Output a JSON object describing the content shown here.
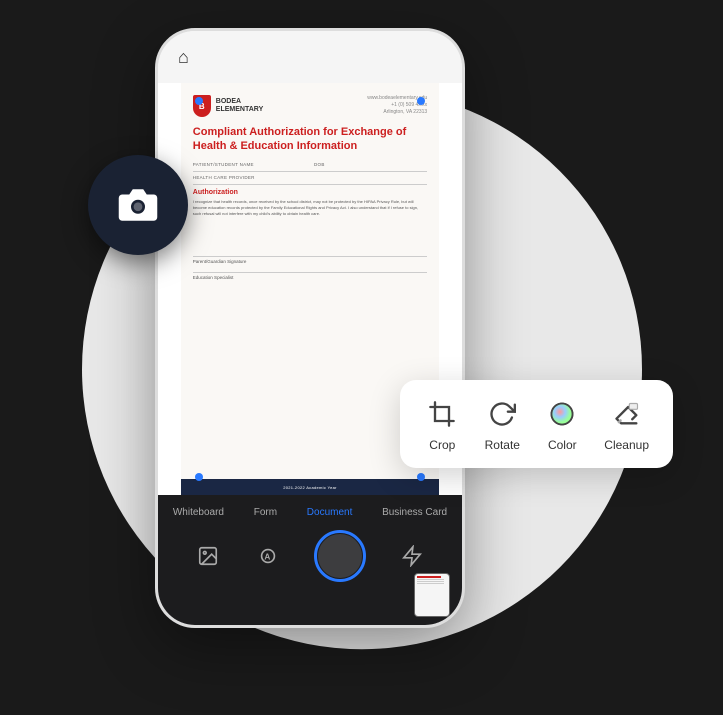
{
  "scene": {
    "bg_color": "#1a1a1a"
  },
  "phone": {
    "home_icon": "⌂",
    "document": {
      "logo_letter": "B",
      "school_name_line1": "BODEA",
      "school_name_line2": "ELEMENTARY",
      "address_line1": "www.bodeaelementary.edu",
      "address_line2": "+1 (0) 509 4x.xx",
      "address_line3": "Arlington, VA 22313",
      "title": "Compliant Authorization for Exchange of Health & Education Information",
      "label1": "PATIENT/STUDENT NAME",
      "label2": "DOB",
      "provider_label": "HEALTH CARE PROVIDER",
      "section_title": "Authorization",
      "body_text": "I recognize that health records, once received by the school district, may not be protected by the HIPAA Privacy Rule, but will become education records protected by the Family Educational Rights and Privacy Act. I also understand that if I refuse to sign, such refusal will not interfere with my child's ability to obtain health care.",
      "signature_label": "Parent/Guardian Signature",
      "specialist_label": "Education Specialist",
      "footer_text": "2021-2022 Academic Year"
    }
  },
  "nav_tabs": [
    {
      "label": "Whiteboard",
      "active": false
    },
    {
      "label": "Form",
      "active": false
    },
    {
      "label": "Document",
      "active": true
    },
    {
      "label": "Business Card",
      "active": false
    }
  ],
  "nav_actions": [
    {
      "name": "gallery-icon",
      "symbol": "⊞"
    },
    {
      "name": "text-icon",
      "symbol": "Ⓐ"
    },
    {
      "name": "capture-button",
      "symbol": ""
    },
    {
      "name": "flash-icon",
      "symbol": "⚡"
    },
    {
      "name": "thumbnail",
      "symbol": ""
    }
  ],
  "toolbar": {
    "tools": [
      {
        "name": "crop",
        "label": "Crop"
      },
      {
        "name": "rotate",
        "label": "Rotate"
      },
      {
        "name": "color",
        "label": "Color"
      },
      {
        "name": "cleanup",
        "label": "Cleanup"
      }
    ]
  }
}
